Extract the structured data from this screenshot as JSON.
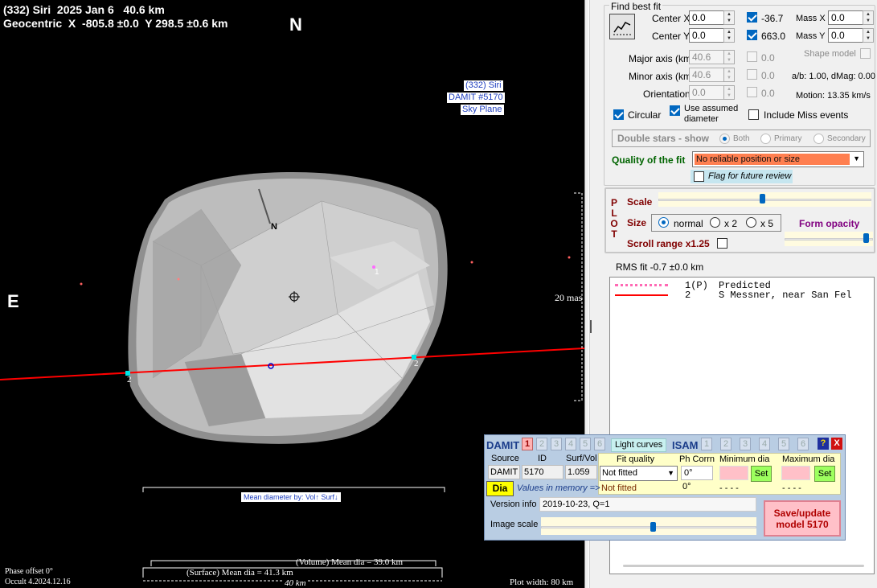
{
  "plot": {
    "header_line1": "(332) Siri  2025 Jan 6   40.6 km",
    "header_line2": "Geocentric  X  -805.8 ±0.0  Y 298.5 ±0.6 km",
    "north_label": "N",
    "east_label": "E",
    "body_north_label": "N",
    "info_lines": [
      "(332) Siri",
      "DAMIT #5170",
      "Sky Plane"
    ],
    "scale_label": "20 mas",
    "chord_label_left": "2",
    "chord_label_right": "2",
    "marker_label": "1",
    "mean_dia_box": "Mean diameter by: Vol↑ Surf↓",
    "volume_mean_dia": "(Volume) Mean dia = 39.0 km",
    "surface_mean_dia": "(Surface) Mean dia = 41.3 km",
    "km_scale": "40 km",
    "phase_offset": "Phase offset 0°",
    "version": "Occult 4.2024.12.16",
    "plot_width": "Plot width: 80 km"
  },
  "fit": {
    "title": "Find best fit",
    "center_x_label": "Center X",
    "center_x": "0.0",
    "center_y_label": "Center Y",
    "center_y": "0.0",
    "center_x_result": "-36.7",
    "center_y_result": "663.0",
    "mass_x_label": "Mass X",
    "mass_x": "0.0",
    "mass_y_label": "Mass Y",
    "mass_y": "0.0",
    "major_label": "Major axis (km)",
    "major": "40.6",
    "major_result": "0.0",
    "minor_label": "Minor axis (km)",
    "minor": "40.6",
    "minor_result": "0.0",
    "orient_label": "Orientation",
    "orient": "0.0",
    "orient_result": "0.0",
    "shape_model_label": "Shape model",
    "ab_label": "a/b: 1.00, dMag: 0.00",
    "motion_label": "Motion: 13.35 km/s",
    "circular_label": "Circular",
    "use_assumed_label": "Use assumed",
    "use_assumed_label2": "diameter",
    "include_miss_label": "Include Miss events",
    "double_stars_label": "Double stars - show",
    "both_label": "Both",
    "primary_label": "Primary",
    "secondary_label": "Secondary",
    "quality_label": "Quality of the fit",
    "quality_value": "No reliable position or size",
    "flag_label": "Flag for future review"
  },
  "plotopts": {
    "p_letters": [
      "P",
      "L",
      "O",
      "T"
    ],
    "scale_label": "Scale",
    "scale_value": 0.49,
    "size_label": "Size",
    "normal_label": "normal",
    "x2_label": "x 2",
    "x5_label": "x 5",
    "form_opacity_label": "Form opacity",
    "form_opacity_value": 0.95,
    "scroll_range_label": "Scroll range x1.25"
  },
  "rms": "RMS fit -0.7 ±0.0 km",
  "legend": [
    {
      "num": "1(P)",
      "text": "Predicted",
      "style": "dots",
      "color": "#ff69b4"
    },
    {
      "num": "2",
      "text": "S Messner, near San Fel",
      "style": "line",
      "color": "#ff0000"
    }
  ],
  "damit": {
    "title": "DAMIT",
    "tabs": [
      "1",
      "2",
      "3",
      "4",
      "5",
      "6"
    ],
    "light_curves": "Light curves",
    "isam_title": "ISAM",
    "isam_tabs": [
      "1",
      "2",
      "3",
      "4",
      "5",
      "6"
    ],
    "help": "?",
    "close": "X",
    "source_label": "Source",
    "id_label": "ID",
    "surfvol_label": "Surf/Vol",
    "source": "DAMIT",
    "id": "5170",
    "surfvol": "1.059",
    "fit_quality_label": "Fit quality",
    "fit_quality_value": "Not fitted",
    "fit_quality_value2": "Not fitted",
    "ph_corr_label": "Ph Corrn",
    "ph_corr": "0°",
    "ph_corr2": "0°",
    "min_dia_label": "Minimum dia",
    "max_dia_label": "Maximum dia",
    "set_label": "Set",
    "dashes": "- - - -",
    "dia_button": "Dia",
    "values_in_memory": "Values in memory =>",
    "version_info_label": "Version info",
    "version_info": "2019-10-23, Q=1",
    "image_scale_label": "Image scale",
    "image_scale_value": 0.52,
    "save_update": "Save/update model 5170"
  },
  "colors": {
    "plot_bg": "#000000",
    "asteroid": "#bcbcbc",
    "chord": "#ff0000",
    "damit_bg": "#b9cde3",
    "quality_bg": "#ff7f50",
    "save_bg": "#ffc0c8",
    "green_text": "#006400",
    "maroon_text": "#800000"
  }
}
